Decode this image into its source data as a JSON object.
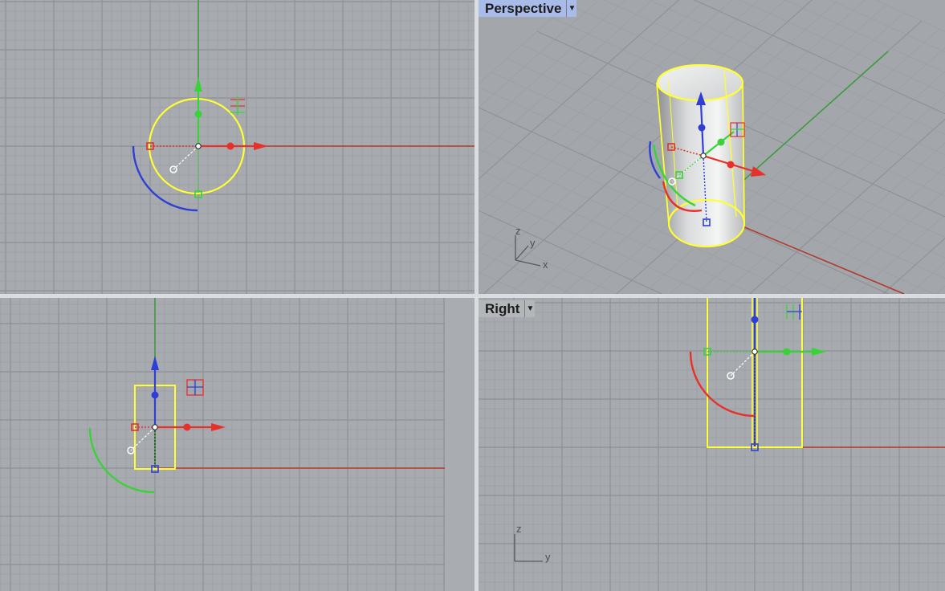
{
  "viewports": {
    "top": {
      "title": ""
    },
    "perspective": {
      "title": "Perspective",
      "active": true,
      "dropdown_icon": "caret-down-icon",
      "axis_labels": {
        "z": "z",
        "y": "y",
        "x": "x"
      }
    },
    "front": {
      "title": ""
    },
    "right": {
      "title": "Right",
      "active": false,
      "dropdown_icon": "caret-down-icon",
      "axis_labels": {
        "z": "z",
        "y": "y"
      }
    }
  },
  "colors": {
    "viewport_bg": "#a7abaf",
    "grid_minor": "#9a9ea2",
    "grid_major": "#8d9196",
    "x_axis": "#b23a2a",
    "y_axis": "#3f9a3f",
    "selection": "#ffff33",
    "gumball_x": "#e8302a",
    "gumball_y": "#39d339",
    "gumball_z": "#2f3fd6",
    "active_tab": "#a9bbe8"
  },
  "gumball_icons": [
    "gumball-x-arrow-icon",
    "gumball-y-arrow-icon",
    "gumball-z-arrow-icon",
    "gumball-rotate-arc-icon",
    "gumball-scale-handle-icon",
    "gumball-menu-icon"
  ]
}
